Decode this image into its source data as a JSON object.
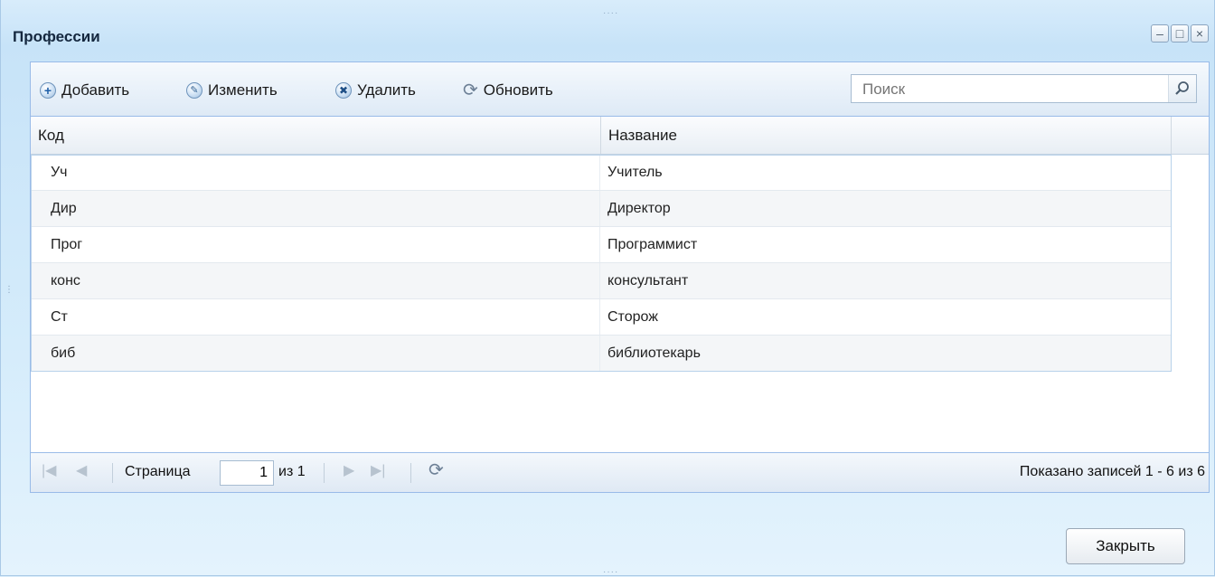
{
  "window": {
    "title": "Профессии"
  },
  "title_buttons": {
    "minimize": "–",
    "maximize": "□",
    "close": "×"
  },
  "toolbar": {
    "add_label": "Добавить",
    "edit_label": "Изменить",
    "delete_label": "Удалить",
    "refresh_label": "Обновить"
  },
  "search": {
    "placeholder": "Поиск"
  },
  "table": {
    "columns": [
      "Код",
      "Название"
    ],
    "rows": [
      [
        "Уч",
        "Учитель"
      ],
      [
        "Дир",
        "Директор"
      ],
      [
        "Прог",
        "Программист"
      ],
      [
        "конс",
        "консультант"
      ],
      [
        "Ст",
        "Сторож"
      ],
      [
        "биб",
        "библиотекарь"
      ]
    ]
  },
  "pager": {
    "page_label": "Страница",
    "page_value": "1",
    "of_label": "из 1",
    "status": "Показано записей 1 - 6 из 6"
  },
  "footer": {
    "close_label": "Закрыть"
  },
  "icons": {
    "add": "plus-circle-icon",
    "edit": "pencil-circle-icon",
    "delete": "x-circle-icon",
    "refresh": "refresh-icon",
    "search": "magnifier-icon"
  }
}
